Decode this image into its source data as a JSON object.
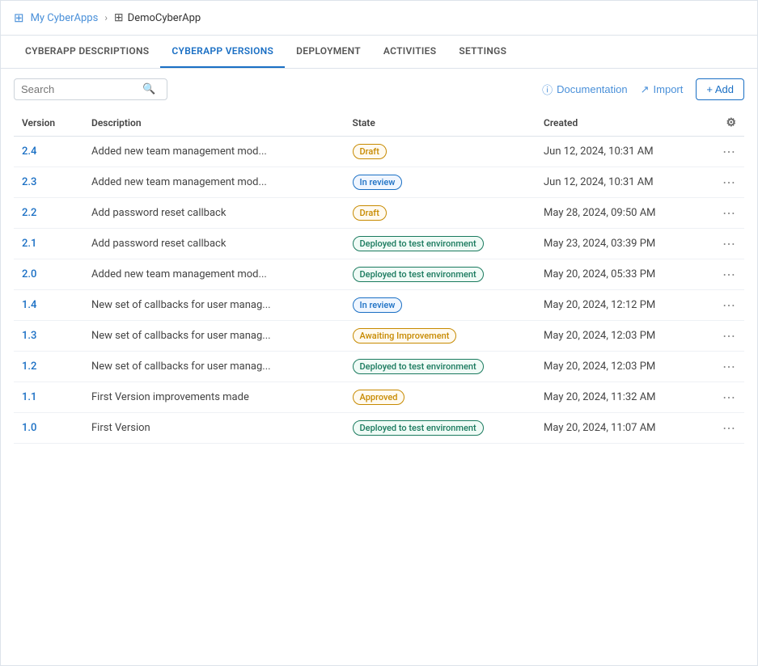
{
  "breadcrumb": {
    "home_label": "My CyberApps",
    "current_label": "DemoCyberApp"
  },
  "tabs": [
    {
      "id": "descriptions",
      "label": "CYBERAPP DESCRIPTIONS",
      "active": false
    },
    {
      "id": "versions",
      "label": "CYBERAPP VERSIONS",
      "active": true
    },
    {
      "id": "deployment",
      "label": "DEPLOYMENT",
      "active": false
    },
    {
      "id": "activities",
      "label": "ACTIVITIES",
      "active": false
    },
    {
      "id": "settings",
      "label": "SETTINGS",
      "active": false
    }
  ],
  "toolbar": {
    "search_placeholder": "Search",
    "doc_label": "Documentation",
    "import_label": "Import",
    "add_label": "+ Add"
  },
  "table": {
    "columns": [
      {
        "id": "version",
        "label": "Version"
      },
      {
        "id": "description",
        "label": "Description"
      },
      {
        "id": "state",
        "label": "State"
      },
      {
        "id": "created",
        "label": "Created"
      },
      {
        "id": "actions",
        "label": ""
      }
    ],
    "rows": [
      {
        "version": "2.4",
        "description": "Added new team management mod...",
        "state": "Draft",
        "state_type": "draft",
        "created": "Jun 12, 2024, 10:31 AM"
      },
      {
        "version": "2.3",
        "description": "Added new team management mod...",
        "state": "In review",
        "state_type": "inreview",
        "created": "Jun 12, 2024, 10:31 AM"
      },
      {
        "version": "2.2",
        "description": "Add password reset callback",
        "state": "Draft",
        "state_type": "draft",
        "created": "May 28, 2024, 09:50 AM"
      },
      {
        "version": "2.1",
        "description": "Add password reset callback",
        "state": "Deployed to test environment",
        "state_type": "deployed",
        "created": "May 23, 2024, 03:39 PM"
      },
      {
        "version": "2.0",
        "description": "Added new team management mod...",
        "state": "Deployed to test environment",
        "state_type": "deployed",
        "created": "May 20, 2024, 05:33 PM"
      },
      {
        "version": "1.4",
        "description": "New set of callbacks for user manag...",
        "state": "In review",
        "state_type": "inreview",
        "created": "May 20, 2024, 12:12 PM"
      },
      {
        "version": "1.3",
        "description": "New set of callbacks for user manag...",
        "state": "Awaiting Improvement",
        "state_type": "awaiting",
        "created": "May 20, 2024, 12:03 PM"
      },
      {
        "version": "1.2",
        "description": "New set of callbacks for user manag...",
        "state": "Deployed to test environment",
        "state_type": "deployed",
        "created": "May 20, 2024, 12:03 PM"
      },
      {
        "version": "1.1",
        "description": "First Version improvements made",
        "state": "Approved",
        "state_type": "approved",
        "created": "May 20, 2024, 11:32 AM"
      },
      {
        "version": "1.0",
        "description": "First Version",
        "state": "Deployed to test environment",
        "state_type": "deployed",
        "created": "May 20, 2024, 11:07 AM"
      }
    ]
  }
}
